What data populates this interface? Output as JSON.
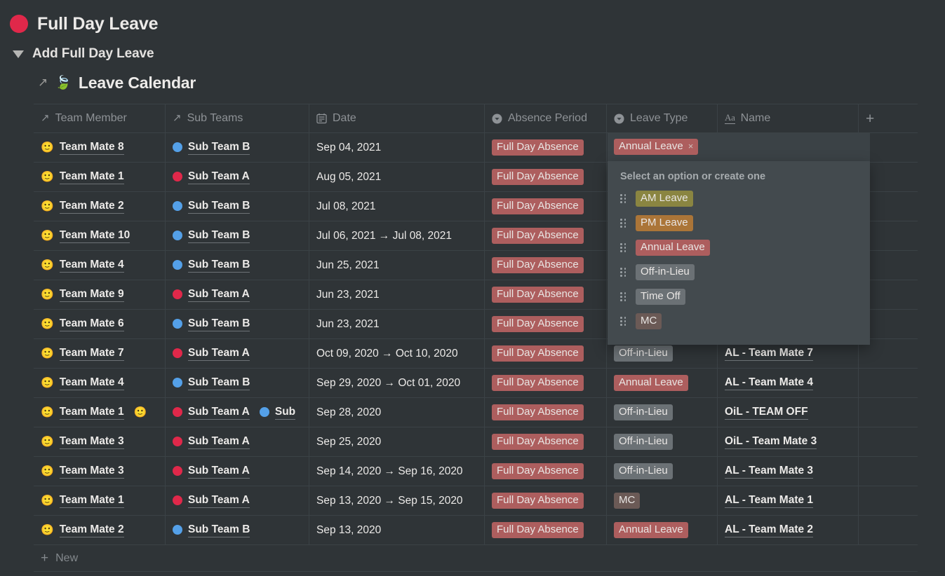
{
  "page": {
    "bullet_color": "#e0284a",
    "title": "Full Day Leave",
    "toggle_label": "Add Full Day Leave",
    "database_title": "Leave Calendar",
    "database_emoji": "🍃",
    "open_arrow_icon": "↗"
  },
  "table": {
    "columns": [
      {
        "label": "Team Member",
        "icon": "relation-arrow-icon"
      },
      {
        "label": "Sub Teams",
        "icon": "relation-arrow-icon"
      },
      {
        "label": "Date",
        "icon": "calendar-icon"
      },
      {
        "label": "Absence Period",
        "icon": "select-icon"
      },
      {
        "label": "Leave Type",
        "icon": "select-icon"
      },
      {
        "label": "Name",
        "icon": "text-aa-icon"
      },
      {
        "label": "+",
        "icon": "add-column-icon"
      }
    ],
    "new_row_label": "New",
    "new_row_icon": "+",
    "rows": [
      {
        "member": [
          {
            "emoji": "🙂",
            "label": "Team Mate 8"
          }
        ],
        "subteams": [
          {
            "color": "#54a0e8",
            "label": "Sub Team B"
          }
        ],
        "date": "Sep 04, 2021",
        "absence": "Full Day Absence",
        "type": "Annual Leave",
        "name": ""
      },
      {
        "member": [
          {
            "emoji": "🙂",
            "label": "Team Mate 1"
          }
        ],
        "subteams": [
          {
            "color": "#e0284a",
            "label": "Sub Team A"
          }
        ],
        "date": "Aug 05, 2021",
        "absence": "Full Day Absence",
        "type": "",
        "name": ""
      },
      {
        "member": [
          {
            "emoji": "🙂",
            "label": "Team Mate 2"
          }
        ],
        "subteams": [
          {
            "color": "#54a0e8",
            "label": "Sub Team B"
          }
        ],
        "date": "Jul 08, 2021",
        "absence": "Full Day Absence",
        "type": "",
        "name": ""
      },
      {
        "member": [
          {
            "emoji": "🙂",
            "label": "Team Mate 10"
          }
        ],
        "subteams": [
          {
            "color": "#54a0e8",
            "label": "Sub Team B"
          }
        ],
        "date": "Jul 06, 2021 → Jul 08, 2021",
        "absence": "Full Day Absence",
        "type": "",
        "name": ""
      },
      {
        "member": [
          {
            "emoji": "🙂",
            "label": "Team Mate 4"
          }
        ],
        "subteams": [
          {
            "color": "#54a0e8",
            "label": "Sub Team B"
          }
        ],
        "date": "Jun 25, 2021",
        "absence": "Full Day Absence",
        "type": "",
        "name": ""
      },
      {
        "member": [
          {
            "emoji": "🙂",
            "label": "Team Mate 9"
          }
        ],
        "subteams": [
          {
            "color": "#e0284a",
            "label": "Sub Team A"
          }
        ],
        "date": "Jun 23, 2021",
        "absence": "Full Day Absence",
        "type": "",
        "name": ""
      },
      {
        "member": [
          {
            "emoji": "🙂",
            "label": "Team Mate 6"
          }
        ],
        "subteams": [
          {
            "color": "#54a0e8",
            "label": "Sub Team B"
          }
        ],
        "date": "Jun 23, 2021",
        "absence": "Full Day Absence",
        "type": "",
        "name": ""
      },
      {
        "member": [
          {
            "emoji": "🙂",
            "label": "Team Mate 7"
          }
        ],
        "subteams": [
          {
            "color": "#e0284a",
            "label": "Sub Team A"
          }
        ],
        "date": "Oct 09, 2020 → Oct 10, 2020",
        "absence": "Full Day Absence",
        "type": "Off-in-Lieu",
        "name": "AL - Team Mate 7"
      },
      {
        "member": [
          {
            "emoji": "🙂",
            "label": "Team Mate 4"
          }
        ],
        "subteams": [
          {
            "color": "#54a0e8",
            "label": "Sub Team B"
          }
        ],
        "date": "Sep 29, 2020 → Oct 01, 2020",
        "absence": "Full Day Absence",
        "type": "Annual Leave",
        "name": "AL - Team Mate 4"
      },
      {
        "member": [
          {
            "emoji": "🙂",
            "label": "Team Mate 1"
          },
          {
            "emoji": "🙂",
            "label": ""
          }
        ],
        "subteams": [
          {
            "color": "#e0284a",
            "label": "Sub Team A"
          },
          {
            "color": "#54a0e8",
            "label": "Sub"
          }
        ],
        "date": "Sep 28, 2020",
        "absence": "Full Day Absence",
        "type": "Off-in-Lieu",
        "name": "OiL - TEAM OFF"
      },
      {
        "member": [
          {
            "emoji": "🙂",
            "label": "Team Mate 3"
          }
        ],
        "subteams": [
          {
            "color": "#e0284a",
            "label": "Sub Team A"
          }
        ],
        "date": "Sep 25, 2020",
        "absence": "Full Day Absence",
        "type": "Off-in-Lieu",
        "name": "OiL - Team Mate 3"
      },
      {
        "member": [
          {
            "emoji": "🙂",
            "label": "Team Mate 3"
          }
        ],
        "subteams": [
          {
            "color": "#e0284a",
            "label": "Sub Team A"
          }
        ],
        "date": "Sep 14, 2020 → Sep 16, 2020",
        "absence": "Full Day Absence",
        "type": "Off-in-Lieu",
        "name": "AL - Team Mate 3"
      },
      {
        "member": [
          {
            "emoji": "🙂",
            "label": "Team Mate 1"
          }
        ],
        "subteams": [
          {
            "color": "#e0284a",
            "label": "Sub Team A"
          }
        ],
        "date": "Sep 13, 2020 → Sep 15, 2020",
        "absence": "Full Day Absence",
        "type": "MC",
        "name": "AL - Team Mate 1"
      },
      {
        "member": [
          {
            "emoji": "🙂",
            "label": "Team Mate 2"
          }
        ],
        "subteams": [
          {
            "color": "#54a0e8",
            "label": "Sub Team B"
          }
        ],
        "date": "Sep 13, 2020",
        "absence": "Full Day Absence",
        "type": "Annual Leave",
        "name": "AL - Team Mate 2"
      }
    ]
  },
  "tag_colors": {
    "Full Day Absence": "#ad5e5e",
    "Annual Leave": "#ad5e5e",
    "Off-in-Lieu": "#6b7175",
    "Time Off": "#6b7175",
    "MC": "#6b5a56",
    "AM Leave": "#8a8541",
    "PM Leave": "#ab7538"
  },
  "dropdown": {
    "selected_tag": "Annual Leave",
    "remove_icon": "×",
    "hint": "Select an option or create one",
    "options": [
      {
        "label": "AM Leave"
      },
      {
        "label": "PM Leave"
      },
      {
        "label": "Annual Leave"
      },
      {
        "label": "Off-in-Lieu"
      },
      {
        "label": "Time Off"
      },
      {
        "label": "MC"
      }
    ]
  }
}
